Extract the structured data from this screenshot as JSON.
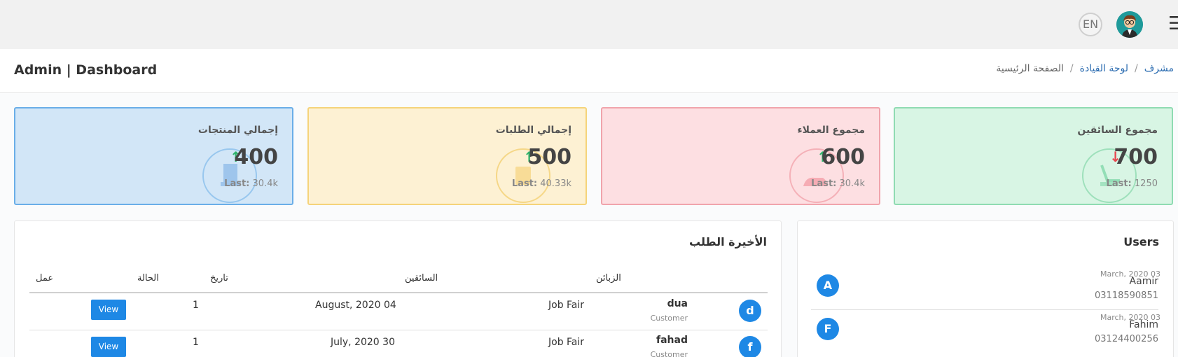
{
  "topbar": {
    "language": "EN",
    "menu_icon": "menu-icon",
    "avatar_icon": "user-avatar"
  },
  "header": {
    "title": "Admin | Dashboard",
    "breadcrumbs": [
      "مشرف",
      "لوحة القيادة",
      "الصفحة الرئيسية"
    ]
  },
  "cards": [
    {
      "title": "إجمالي المنتجات",
      "value": "400",
      "trend": "up",
      "last_label": "Last:",
      "last_value": "30.4k",
      "icon": "products-icon",
      "color": "#6aaee8"
    },
    {
      "title": "إجمالي الطلبات",
      "value": "500",
      "trend": "up",
      "last_label": "Last:",
      "last_value": "40.33k",
      "icon": "orders-icon",
      "color": "#f5d37a"
    },
    {
      "title": "مجموع العملاء",
      "value": "600",
      "trend": "up",
      "last_label": "Last:",
      "last_value": "30.4k",
      "icon": "customers-icon",
      "color": "#f0a4ac"
    },
    {
      "title": "مجموع السائقين",
      "value": "700",
      "trend": "down",
      "last_label": "Last:",
      "last_value": "1250",
      "icon": "drivers-icon",
      "color": "#8fdbb2"
    }
  ],
  "orders": {
    "title": "الأخيرة الطلب",
    "columns": [
      "الزبائن",
      "السائقين",
      "تاريخ",
      "الحالة",
      "عمل"
    ],
    "rows": [
      {
        "letter": "d",
        "name": "dua",
        "role": "Customer",
        "driver": "Job Fair",
        "date": "August, 2020 04",
        "status": "1",
        "action": "View"
      },
      {
        "letter": "f",
        "name": "fahad",
        "role": "Customer",
        "driver": "Job Fair",
        "date": "July, 2020 30",
        "status": "1",
        "action": "View"
      }
    ]
  },
  "users": {
    "title": "Users",
    "items": [
      {
        "letter": "A",
        "name": "Aamir",
        "date": "March, 2020 03",
        "phone": "03118590851"
      },
      {
        "letter": "F",
        "name": "Fahim",
        "date": "March, 2020 03",
        "phone": "03124400256"
      }
    ]
  }
}
